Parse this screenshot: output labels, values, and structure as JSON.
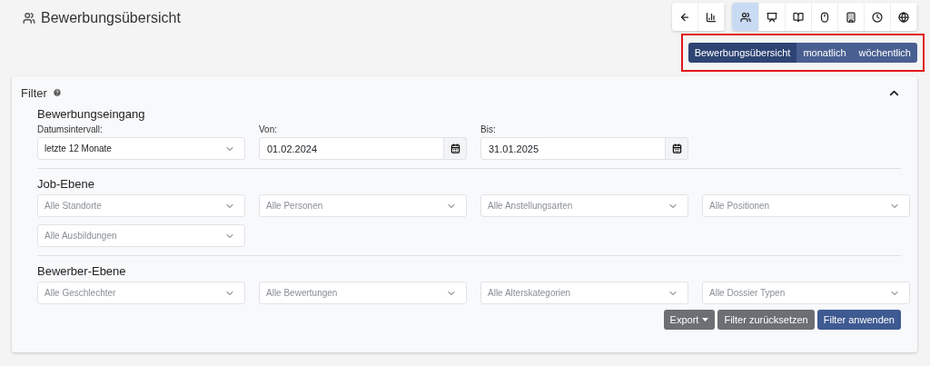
{
  "page": {
    "title": "Bewerbungsübersicht"
  },
  "toolbar": {
    "groups": [
      [
        {
          "selected": false
        },
        {
          "selected": false
        }
      ],
      [
        {
          "selected": true
        },
        {
          "selected": false
        },
        {
          "selected": false
        },
        {
          "selected": false
        },
        {
          "selected": false
        },
        {
          "selected": false
        },
        {
          "selected": false
        }
      ]
    ]
  },
  "view_switch": {
    "highlighted": true,
    "options": [
      {
        "label": "Bewerbungsübersicht",
        "selected": true
      },
      {
        "label": "monatlich",
        "selected": false
      },
      {
        "label": "wöchentlich",
        "selected": false
      }
    ]
  },
  "filter": {
    "title": "Filter",
    "expanded": true,
    "sections": [
      {
        "heading": "Bewerbungseingang",
        "fields": [
          {
            "kind": "select",
            "label": "Datumsintervall:",
            "value": "letzte 12 Monate"
          },
          {
            "kind": "date",
            "label": "Von:",
            "value": "01.02.2024"
          },
          {
            "kind": "date",
            "label": "Bis:",
            "value": "31.01.2025"
          }
        ]
      },
      {
        "heading": "Job-Ebene",
        "fields": [
          {
            "kind": "select",
            "placeholder": "Alle Standorte"
          },
          {
            "kind": "select",
            "placeholder": "Alle Personen"
          },
          {
            "kind": "select",
            "placeholder": "Alle Anstellungsarten"
          },
          {
            "kind": "select",
            "placeholder": "Alle Positionen"
          },
          {
            "kind": "select",
            "placeholder": "Alle Ausbildungen"
          }
        ]
      },
      {
        "heading": "Bewerber-Ebene",
        "fields": [
          {
            "kind": "select",
            "placeholder": "Alle Geschlechter"
          },
          {
            "kind": "select",
            "placeholder": "Alle Bewertungen"
          },
          {
            "kind": "select",
            "placeholder": "Alle Alterskategorien"
          },
          {
            "kind": "select",
            "placeholder": "Alle Dossier Typen"
          }
        ]
      }
    ],
    "buttons": [
      {
        "kind": "dropdown",
        "label": "Export"
      },
      {
        "kind": "secondary",
        "label": "Filter zurücksetzen"
      },
      {
        "kind": "primary",
        "label": "Filter anwenden"
      }
    ]
  }
}
